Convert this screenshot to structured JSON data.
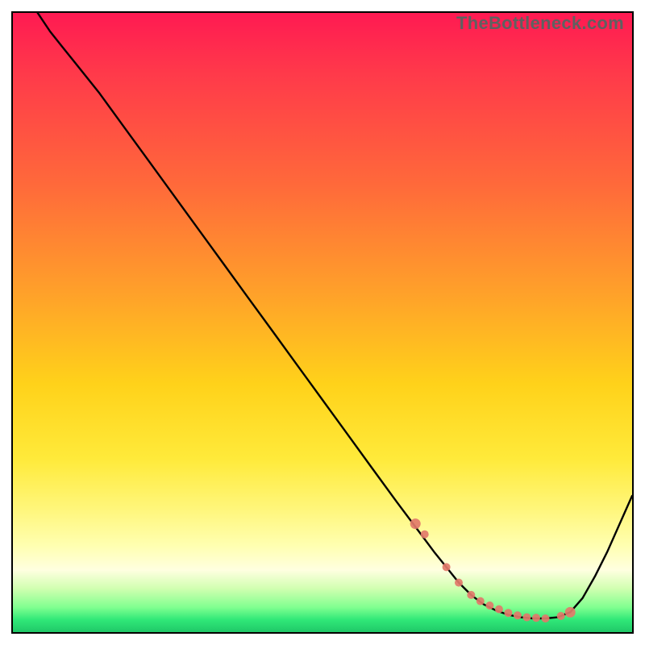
{
  "watermark": "TheBottleneck.com",
  "chart_data": {
    "type": "line",
    "title": "",
    "xlabel": "",
    "ylabel": "",
    "xlim": [
      0,
      100
    ],
    "ylim": [
      0,
      100
    ],
    "grid": false,
    "legend": false,
    "series": [
      {
        "name": "bottleneck-curve",
        "color": "#000000",
        "x": [
          4,
          6,
          8,
          10,
          14,
          18,
          22,
          26,
          30,
          34,
          38,
          42,
          46,
          50,
          54,
          58,
          62,
          65,
          68,
          70,
          72,
          74,
          76,
          78,
          80,
          82,
          84,
          86,
          88,
          90,
          92,
          94,
          96,
          100
        ],
        "y": [
          100,
          97,
          94.5,
          92,
          87,
          81.5,
          76,
          70.5,
          65,
          59.5,
          54,
          48.5,
          43,
          37.5,
          32,
          26.5,
          21,
          17,
          13,
          10.5,
          8,
          6,
          4.5,
          3.5,
          2.8,
          2.4,
          2.2,
          2.2,
          2.4,
          3.2,
          5.5,
          9,
          13,
          22
        ]
      }
    ],
    "markers": {
      "name": "highlight-dots",
      "color": "#e27a6a",
      "x": [
        65,
        66.5,
        70,
        72,
        74,
        75.5,
        77,
        78.5,
        80,
        81.5,
        83,
        84.5,
        86,
        88.5,
        90
      ],
      "y": [
        17.5,
        15.8,
        10.5,
        8,
        6,
        5,
        4.3,
        3.7,
        3.1,
        2.7,
        2.4,
        2.3,
        2.2,
        2.6,
        3.2
      ]
    },
    "annotations": []
  }
}
